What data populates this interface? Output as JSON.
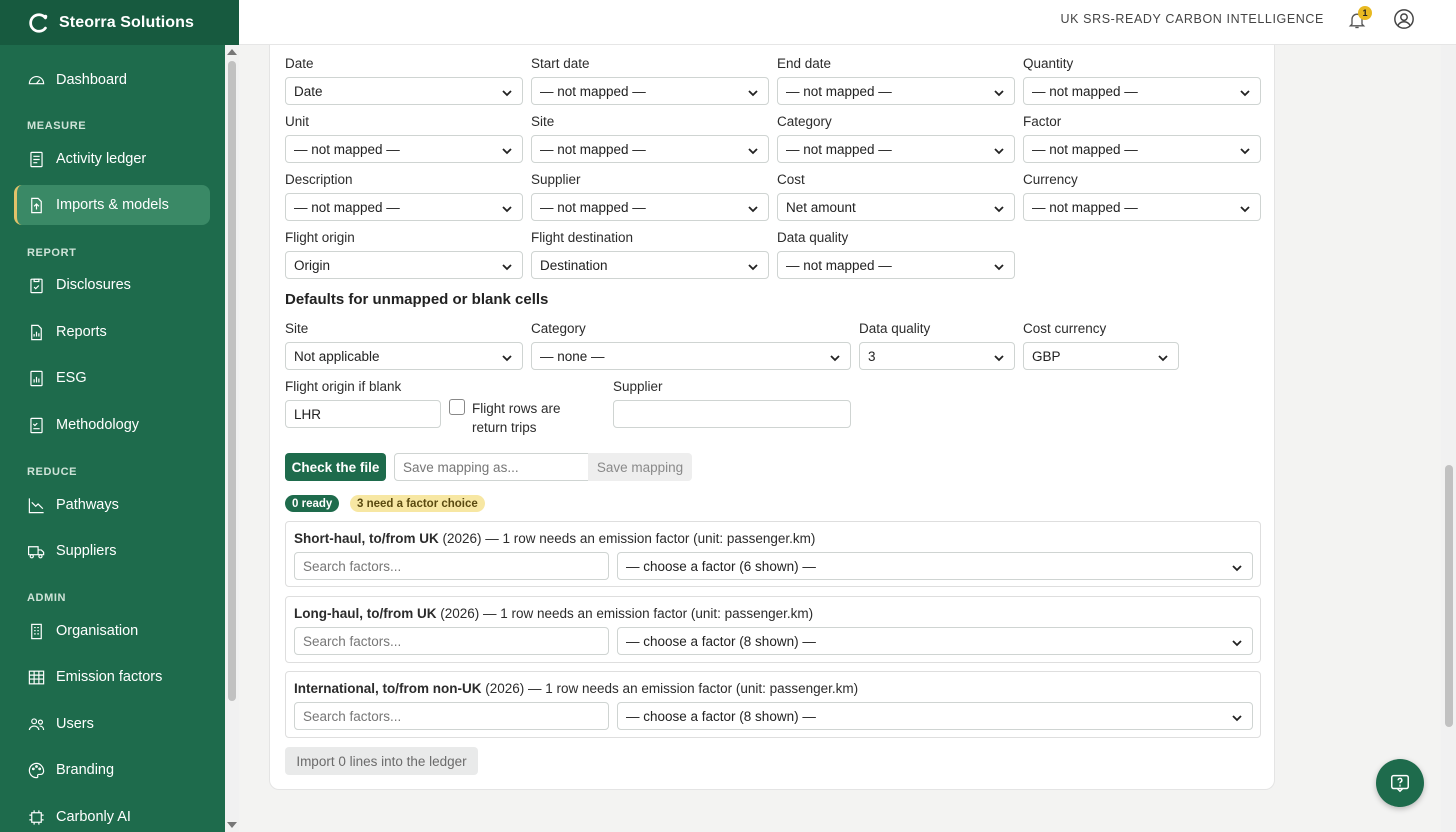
{
  "brand": {
    "name": "Steorra Solutions"
  },
  "topbar": {
    "tagline": "UK SRS-READY CARBON INTELLIGENCE",
    "notification_count": "1"
  },
  "sidebar": {
    "dashboard": "Dashboard",
    "measure_label": "MEASURE",
    "activity_ledger": "Activity ledger",
    "imports_models": "Imports & models",
    "report_label": "REPORT",
    "disclosures": "Disclosures",
    "reports": "Reports",
    "esg": "ESG",
    "methodology": "Methodology",
    "reduce_label": "REDUCE",
    "pathways": "Pathways",
    "suppliers": "Suppliers",
    "admin_label": "ADMIN",
    "organisation": "Organisation",
    "emission_factors": "Emission factors",
    "users": "Users",
    "branding": "Branding",
    "carbonly_ai": "Carbonly AI"
  },
  "mapping": {
    "date": {
      "label": "Date",
      "value": "Date"
    },
    "start_date": {
      "label": "Start date",
      "value": "— not mapped —"
    },
    "end_date": {
      "label": "End date",
      "value": "— not mapped —"
    },
    "quantity": {
      "label": "Quantity",
      "value": "— not mapped —"
    },
    "unit": {
      "label": "Unit",
      "value": "— not mapped —"
    },
    "site": {
      "label": "Site",
      "value": "— not mapped —"
    },
    "category": {
      "label": "Category",
      "value": "— not mapped —"
    },
    "factor": {
      "label": "Factor",
      "value": "— not mapped —"
    },
    "description": {
      "label": "Description",
      "value": "— not mapped —"
    },
    "supplier": {
      "label": "Supplier",
      "value": "— not mapped —"
    },
    "cost": {
      "label": "Cost",
      "value": "Net amount"
    },
    "currency": {
      "label": "Currency",
      "value": "— not mapped —"
    },
    "flight_origin": {
      "label": "Flight origin",
      "value": "Origin"
    },
    "flight_destination": {
      "label": "Flight destination",
      "value": "Destination"
    },
    "data_quality": {
      "label": "Data quality",
      "value": "— not mapped —"
    }
  },
  "defaults": {
    "title": "Defaults for unmapped or blank cells",
    "site": {
      "label": "Site",
      "value": "Not applicable"
    },
    "category": {
      "label": "Category",
      "value": "— none —"
    },
    "data_quality": {
      "label": "Data quality",
      "value": "3"
    },
    "cost_currency": {
      "label": "Cost currency",
      "value": "GBP"
    },
    "flight_origin_blank": {
      "label": "Flight origin if blank",
      "value": "LHR"
    },
    "return_trips": {
      "label": "Flight rows are return trips",
      "checked": false
    },
    "supplier": {
      "label": "Supplier",
      "value": ""
    }
  },
  "actions": {
    "check_file": "Check the file",
    "save_mapping_placeholder": "Save mapping as...",
    "save_mapping": "Save mapping",
    "import": "Import 0 lines into the ledger"
  },
  "status": {
    "ready": "0 ready",
    "need_factor": "3 need a factor choice"
  },
  "factor_rows": [
    {
      "name": "Short-haul, to/from UK",
      "rest": " (2026) — 1 row needs an emission factor (unit: passenger.km)",
      "search_placeholder": "Search factors...",
      "choice": "— choose a factor (6 shown) —"
    },
    {
      "name": "Long-haul, to/from UK",
      "rest": " (2026) — 1 row needs an emission factor (unit: passenger.km)",
      "search_placeholder": "Search factors...",
      "choice": "— choose a factor (8 shown) —"
    },
    {
      "name": "International, to/from non-UK",
      "rest": " (2026) — 1 row needs an emission factor (unit: passenger.km)",
      "search_placeholder": "Search factors...",
      "choice": "— choose a factor (8 shown) —"
    }
  ],
  "colors": {
    "brand_green": "#1e6b4c",
    "accent_gold": "#e2c36a",
    "badge_yellow": "#e8b921"
  }
}
